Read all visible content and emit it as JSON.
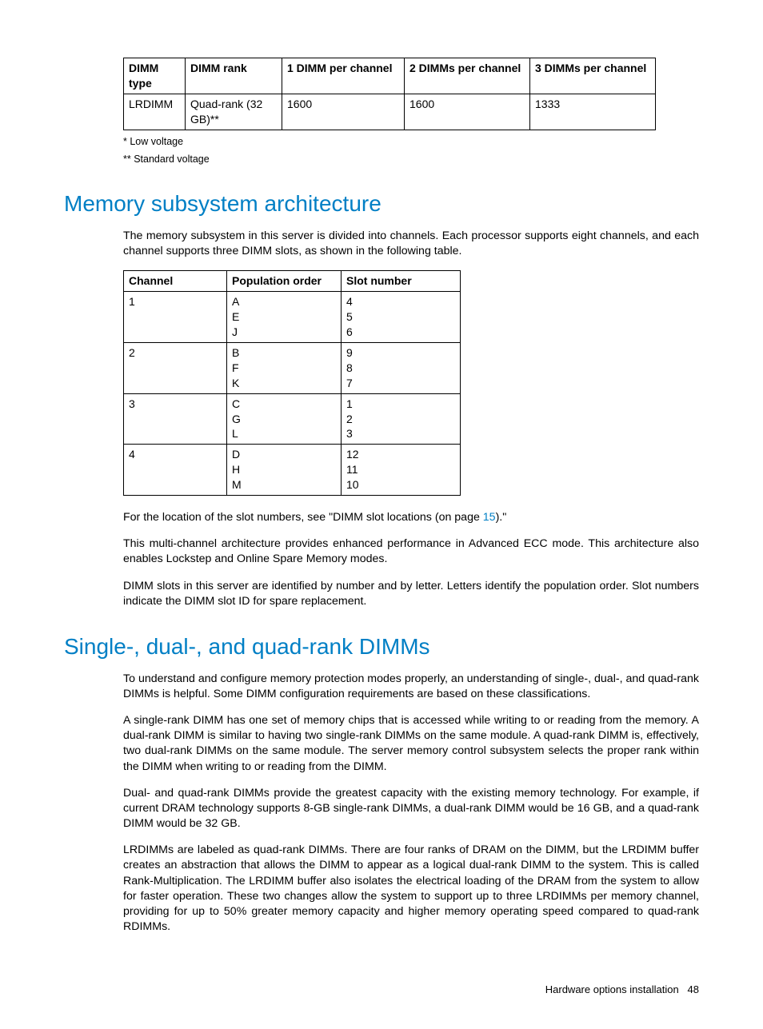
{
  "table1": {
    "headers": [
      "DIMM type",
      "DIMM rank",
      "1 DIMM per channel",
      "2 DIMMs per channel",
      "3 DIMMs per channel"
    ],
    "row": [
      "LRDIMM",
      "Quad-rank (32 GB)**",
      "1600",
      "1600",
      "1333"
    ]
  },
  "footnotes": {
    "f1": "* Low voltage",
    "f2": "** Standard voltage"
  },
  "heading1": "Memory subsystem architecture",
  "para_h1_1": "The memory subsystem in this server is divided into channels. Each processor supports eight channels, and each channel supports three DIMM slots, as shown in the following table.",
  "table2": {
    "headers": [
      "Channel",
      "Population order",
      "Slot number"
    ],
    "rows": [
      {
        "channel": "1",
        "pop": [
          "A",
          "E",
          "J"
        ],
        "slot": [
          "4",
          "5",
          "6"
        ]
      },
      {
        "channel": "2",
        "pop": [
          "B",
          "F",
          "K"
        ],
        "slot": [
          "9",
          "8",
          "7"
        ]
      },
      {
        "channel": "3",
        "pop": [
          "C",
          "G",
          "L"
        ],
        "slot": [
          "1",
          "2",
          "3"
        ]
      },
      {
        "channel": "4",
        "pop": [
          "D",
          "H",
          "M"
        ],
        "slot": [
          "12",
          "11",
          "10"
        ]
      }
    ]
  },
  "para_h1_2_pre": "For the location of the slot numbers, see \"DIMM slot locations (on page ",
  "para_h1_2_link": "15",
  "para_h1_2_post": ").\"",
  "para_h1_3": "This multi-channel architecture provides enhanced performance in Advanced ECC mode. This architecture also enables Lockstep and Online Spare Memory modes.",
  "para_h1_4": "DIMM slots in this server are identified by number and by letter. Letters identify the population order. Slot numbers indicate the DIMM slot ID for spare replacement.",
  "heading2": "Single-, dual-, and quad-rank DIMMs",
  "para_h2_1": "To understand and configure memory protection modes properly, an understanding of single-, dual-, and quad-rank DIMMs is helpful. Some DIMM configuration requirements are based on these classifications.",
  "para_h2_2": "A single-rank DIMM has one set of memory chips that is accessed while writing to or reading from the memory. A dual-rank DIMM is similar to having two single-rank DIMMs on the same module. A quad-rank DIMM is, effectively, two dual-rank DIMMs on the same module. The server memory control subsystem selects the proper rank within the DIMM when writing to or reading from the DIMM.",
  "para_h2_3": "Dual- and quad-rank DIMMs provide the greatest capacity with the existing memory technology. For example, if current DRAM technology supports 8-GB single-rank DIMMs, a dual-rank DIMM would be 16 GB, and a quad-rank DIMM would be 32 GB.",
  "para_h2_4": "LRDIMMs are labeled as quad-rank DIMMs. There are four ranks of DRAM on the DIMM, but the LRDIMM buffer creates an abstraction that allows the DIMM to appear as a logical dual-rank DIMM to the system. This is called Rank-Multiplication. The LRDIMM buffer also isolates the electrical loading of the DRAM from the system to allow for faster operation. These two changes allow the system to support up to three LRDIMMs per memory channel, providing for up to 50% greater memory capacity and higher memory operating speed compared to quad-rank RDIMMs.",
  "footer": {
    "section": "Hardware options installation",
    "page": "48"
  }
}
